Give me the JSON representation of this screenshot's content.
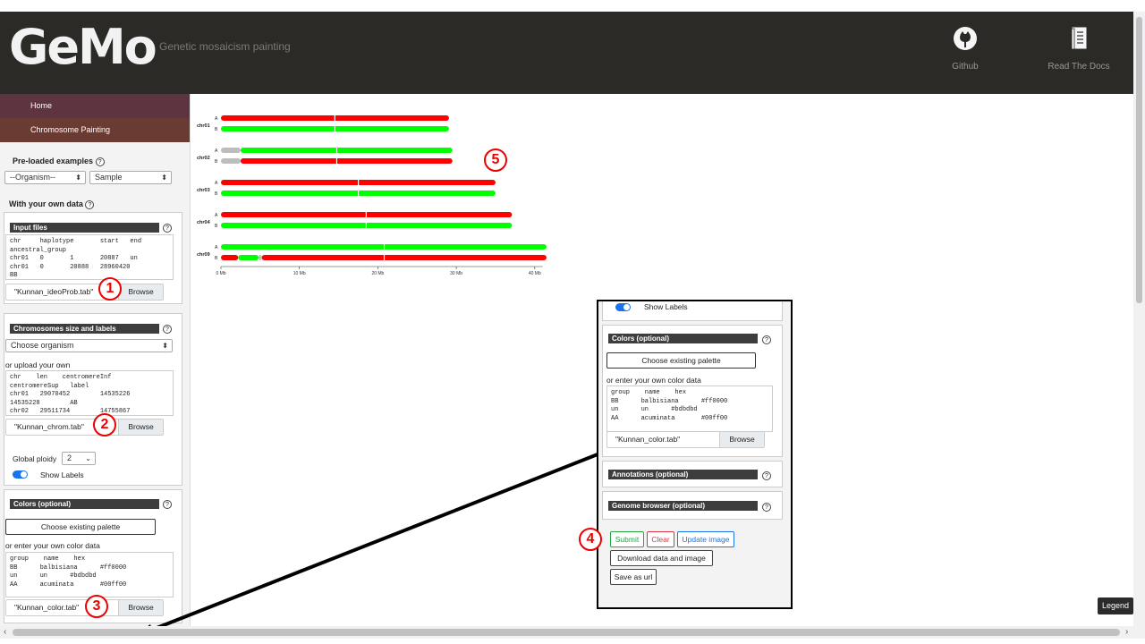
{
  "header": {
    "logo_text": "GeMo",
    "tagline": "Genetic mosaicism painting",
    "links": [
      {
        "label": "Github",
        "icon": "github-icon"
      },
      {
        "label": "Read The Docs",
        "icon": "book-icon"
      }
    ]
  },
  "nav": {
    "home": "Home",
    "painting": "Chromosome Painting"
  },
  "preloaded": {
    "title": "Pre-loaded examples",
    "organism": "--Organism--",
    "sample": "Sample"
  },
  "own_data": {
    "title": "With your own data"
  },
  "input_files": {
    "title": "Input files",
    "content": "chr     haplotype       start   end\nancestral_group\nchr01   0       1       20887   un\nchr01   0       20888   28960420\nBB",
    "file_name": "\"Kunnan_ideoProb.tab\"",
    "browse": "Browse"
  },
  "chrom_size": {
    "title": "Chromosomes size and labels",
    "organism_select": "Choose organism",
    "upload_text": "or upload your own",
    "content": "chr    len    centromereInf\ncentromereSup   label\nchr01   29070452        14535226\n14535228        AB\nchr02   29511734        14755867",
    "file_name": "\"Kunnan_chrom.tab\"",
    "browse": "Browse",
    "ploidy_label": "Global ploidy",
    "ploidy_value": "2",
    "show_labels": "Show Labels"
  },
  "colors": {
    "title": "Colors (optional)",
    "palette_button": "Choose existing palette",
    "enter_text": "or enter your own color data",
    "content": "group    name    hex\nBB      balbisiana      #ff0000\nun      un      #bdbdbd\nAA      acuminata       #00ff00",
    "file_name": "\"Kunnan_color.tab\"",
    "browse": "Browse"
  },
  "zoom": {
    "show_labels": "Show Labels",
    "colors_title": "Colors (optional)",
    "palette_button": "Choose existing palette",
    "enter_text": "or enter your own color data",
    "content": "group    name    hex\nBB      balbisiana      #ff0000\nun      un      #bdbdbd\nAA      acuminata       #00ff00",
    "file_name": "\"Kunnan_color.tab\"",
    "browse": "Browse",
    "annotations_title": "Annotations (optional)",
    "genome_browser_title": "Genome browser (optional)",
    "submit": "Submit",
    "clear": "Clear",
    "update_image": "Update image",
    "download": "Download data and image",
    "save_url": "Save as url"
  },
  "callouts": [
    "1",
    "2",
    "3",
    "4",
    "5"
  ],
  "legend_button": "Legend",
  "help_glyph": "?",
  "colors_map": {
    "BB": "#ff0000",
    "un": "#bdbdbd",
    "AA": "#00ff00"
  },
  "chart_data": {
    "type": "ideogram",
    "x_unit": "Mb",
    "xlim": [
      0,
      41
    ],
    "ticks": [
      "0 Mb",
      "10 Mb",
      "20 Mb",
      "30 Mb",
      "40 Mb"
    ],
    "tick_values": [
      0,
      10,
      20,
      30,
      40
    ],
    "chromosomes": [
      {
        "name": "chr01",
        "length": 29.07,
        "centromere": 14.5,
        "haplotypes": [
          {
            "label": "A",
            "segments": [
              {
                "start": 0,
                "end": 29.07,
                "group": "BB"
              }
            ]
          },
          {
            "label": "B",
            "segments": [
              {
                "start": 0,
                "end": 29.07,
                "group": "AA"
              }
            ]
          }
        ]
      },
      {
        "name": "chr02",
        "length": 29.5,
        "centromere": 14.75,
        "haplotypes": [
          {
            "label": "A",
            "segments": [
              {
                "start": 0,
                "end": 2.5,
                "group": "un"
              },
              {
                "start": 2.5,
                "end": 29.5,
                "group": "AA"
              }
            ]
          },
          {
            "label": "B",
            "segments": [
              {
                "start": 0,
                "end": 2.5,
                "group": "un"
              },
              {
                "start": 2.5,
                "end": 29.5,
                "group": "BB"
              }
            ]
          }
        ]
      },
      {
        "name": "chr03",
        "length": 35.0,
        "centromere": 17.5,
        "haplotypes": [
          {
            "label": "A",
            "segments": [
              {
                "start": 0,
                "end": 35.0,
                "group": "BB"
              }
            ]
          },
          {
            "label": "B",
            "segments": [
              {
                "start": 0,
                "end": 35.0,
                "group": "AA"
              }
            ]
          }
        ]
      },
      {
        "name": "chr04",
        "length": 37.1,
        "centromere": 18.5,
        "haplotypes": [
          {
            "label": "A",
            "segments": [
              {
                "start": 0,
                "end": 37.1,
                "group": "BB"
              }
            ]
          },
          {
            "label": "B",
            "segments": [
              {
                "start": 0,
                "end": 37.1,
                "group": "AA"
              }
            ]
          }
        ]
      },
      {
        "name": "chr09",
        "length": 41.5,
        "centromere": 20.8,
        "haplotypes": [
          {
            "label": "A",
            "segments": [
              {
                "start": 0,
                "end": 41.5,
                "group": "AA"
              }
            ]
          },
          {
            "label": "B",
            "segments": [
              {
                "start": 0,
                "end": 2.2,
                "group": "BB"
              },
              {
                "start": 2.2,
                "end": 4.8,
                "group": "AA"
              },
              {
                "start": 4.8,
                "end": 5.2,
                "group": "un"
              },
              {
                "start": 5.2,
                "end": 41.5,
                "group": "BB"
              }
            ]
          }
        ]
      }
    ]
  }
}
